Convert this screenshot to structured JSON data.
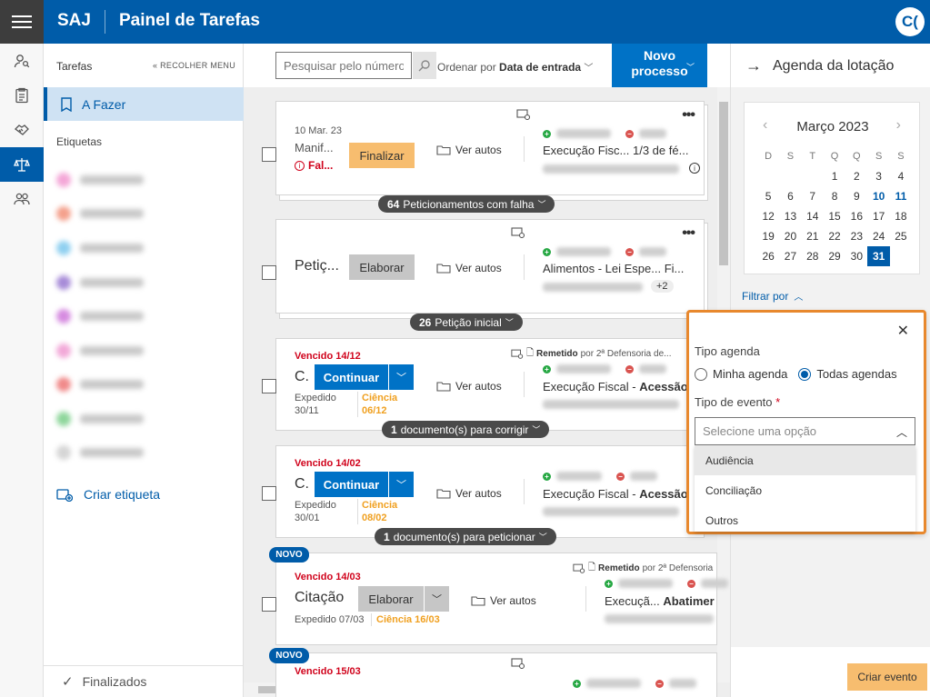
{
  "topbar": {
    "brand": "SAJ",
    "title": "Painel de Tarefas",
    "avatar": "C("
  },
  "leftnav": {
    "header": "Tarefas",
    "collapse": "« RECOLHER MENU",
    "active_item": "A Fazer",
    "tags_header": "Etiquetas",
    "create_tag": "Criar etiqueta",
    "finished": "Finalizados"
  },
  "toolbar": {
    "search_placeholder": "Pesquisar pelo número",
    "order_prefix": "Ordenar por",
    "order_value": "Data de entrada",
    "new_process": "Novo processo"
  },
  "cards": [
    {
      "date": "10 Mar. 23",
      "title": "Manif...",
      "warn": "Fal...",
      "button": "Finalizar",
      "view": "Ver autos",
      "classe": "Execução Fisc...",
      "assunto": "1/3 de fé...",
      "pill_count": "64",
      "pill_text": "Peticionamentos com falha"
    },
    {
      "title": "Petiç...",
      "button": "Elaborar",
      "view": "Ver autos",
      "classe": "Alimentos - Lei Espe...",
      "assunto": "Fi...",
      "extra": "+2",
      "pill_count": "26",
      "pill_text": "Petição inicial"
    },
    {
      "due": "Vencido 14/12",
      "remetido": "Remetido",
      "remetido_by": "por 2ª Defensoria de...",
      "title": "C.",
      "button": "Continuar",
      "view": "Ver autos",
      "exp_label": "Expedido",
      "exp_date": "30/11",
      "ciencia_label": "Ciência",
      "ciencia_date": "06/12",
      "classe": "Execução Fiscal -",
      "assunto": "Acessão",
      "pill_count": "1",
      "pill_text": "documento(s) para corrigir"
    },
    {
      "due": "Vencido 14/02",
      "title": "C.",
      "button": "Continuar",
      "view": "Ver autos",
      "exp_label": "Expedido",
      "exp_date": "30/01",
      "ciencia_label": "Ciência",
      "ciencia_date": "08/02",
      "classe": "Execução Fiscal -",
      "assunto": "Acessão",
      "pill_count": "1",
      "pill_text": "documento(s) para peticionar"
    },
    {
      "novo": "NOVO",
      "due": "Vencido 14/03",
      "remetido": "Remetido",
      "remetido_by": "por 2ª Defensoria",
      "title": "Citação",
      "button": "Elaborar",
      "view": "Ver autos",
      "exp_label": "Expedido 07/03",
      "ciencia_label": "Ciência 16/03",
      "classe": "Execuçã...",
      "assunto": "Abatimer"
    },
    {
      "novo": "NOVO",
      "due": "Vencido 15/03"
    }
  ],
  "right": {
    "header": "Agenda da lotação",
    "calendar": {
      "month": "Março 2023",
      "dow": [
        "D",
        "S",
        "T",
        "Q",
        "Q",
        "S",
        "S"
      ],
      "first_weekday": 3,
      "days": 31,
      "today": 31,
      "highlighted": [
        10,
        11
      ]
    },
    "filter": "Filtrar por",
    "create_event": "Criar evento"
  },
  "popup": {
    "agenda_label": "Tipo agenda",
    "opt_mine": "Minha agenda",
    "opt_all": "Todas agendas",
    "event_label": "Tipo de evento",
    "required": "*",
    "select_placeholder": "Selecione uma opção",
    "options": [
      "Audiência",
      "Conciliação",
      "Outros"
    ]
  },
  "colors": {
    "brand": "#005ca9",
    "accent": "#0072c6",
    "warn_button": "#f7bd6f",
    "popup_border": "#e8882d"
  }
}
